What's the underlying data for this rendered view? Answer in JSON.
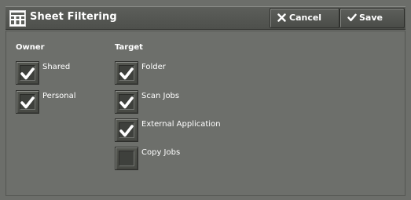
{
  "header": {
    "title": "Sheet Filtering",
    "title_icon": "sheet-filtering-icon",
    "cancel_label": "Cancel",
    "cancel_icon": "close-icon",
    "save_label": "Save",
    "save_icon": "checkmark-icon"
  },
  "owner": {
    "heading": "Owner",
    "items": [
      {
        "label": "Shared",
        "checked": true
      },
      {
        "label": "Personal",
        "checked": true
      }
    ]
  },
  "target": {
    "heading": "Target",
    "items": [
      {
        "label": "Folder",
        "checked": true
      },
      {
        "label": "Scan Jobs",
        "checked": true
      },
      {
        "label": "External Application",
        "checked": true
      },
      {
        "label": "Copy Jobs",
        "checked": false
      }
    ]
  },
  "colors": {
    "background": "#6c6e6a",
    "text": "#ffffff"
  }
}
